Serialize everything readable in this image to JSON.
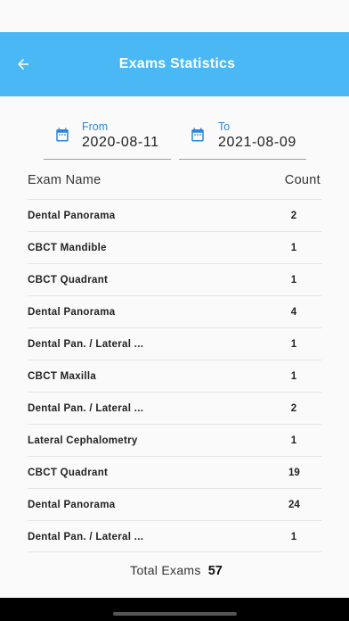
{
  "header": {
    "title": "Exams Statistics",
    "back_icon": "arrow-left-icon"
  },
  "filters": {
    "from": {
      "label": "From",
      "value": "2020-08-11",
      "icon": "calendar-icon"
    },
    "to": {
      "label": "To",
      "value": "2021-08-09",
      "icon": "calendar-icon"
    }
  },
  "table": {
    "headers": {
      "name": "Exam Name",
      "count": "Count"
    },
    "rows": [
      {
        "name": "Dental Panorama",
        "count": "2"
      },
      {
        "name": "CBCT Mandible",
        "count": "1"
      },
      {
        "name": "CBCT Quadrant",
        "count": "1"
      },
      {
        "name": "Dental Panorama",
        "count": "4"
      },
      {
        "name": "Dental Pan. / Lateral ...",
        "count": "1"
      },
      {
        "name": "CBCT Maxilla",
        "count": "1"
      },
      {
        "name": "Dental Pan. / Lateral ...",
        "count": "2"
      },
      {
        "name": "Lateral Cephalometry",
        "count": "1"
      },
      {
        "name": "CBCT Quadrant",
        "count": "19"
      },
      {
        "name": "Dental Panorama",
        "count": "24"
      },
      {
        "name": "Dental Pan. / Lateral ...",
        "count": "1"
      }
    ]
  },
  "footer": {
    "total_label": "Total Exams",
    "total_value": "57"
  },
  "colors": {
    "appbar": "#4ab8f5",
    "accent": "#2f86d8"
  }
}
